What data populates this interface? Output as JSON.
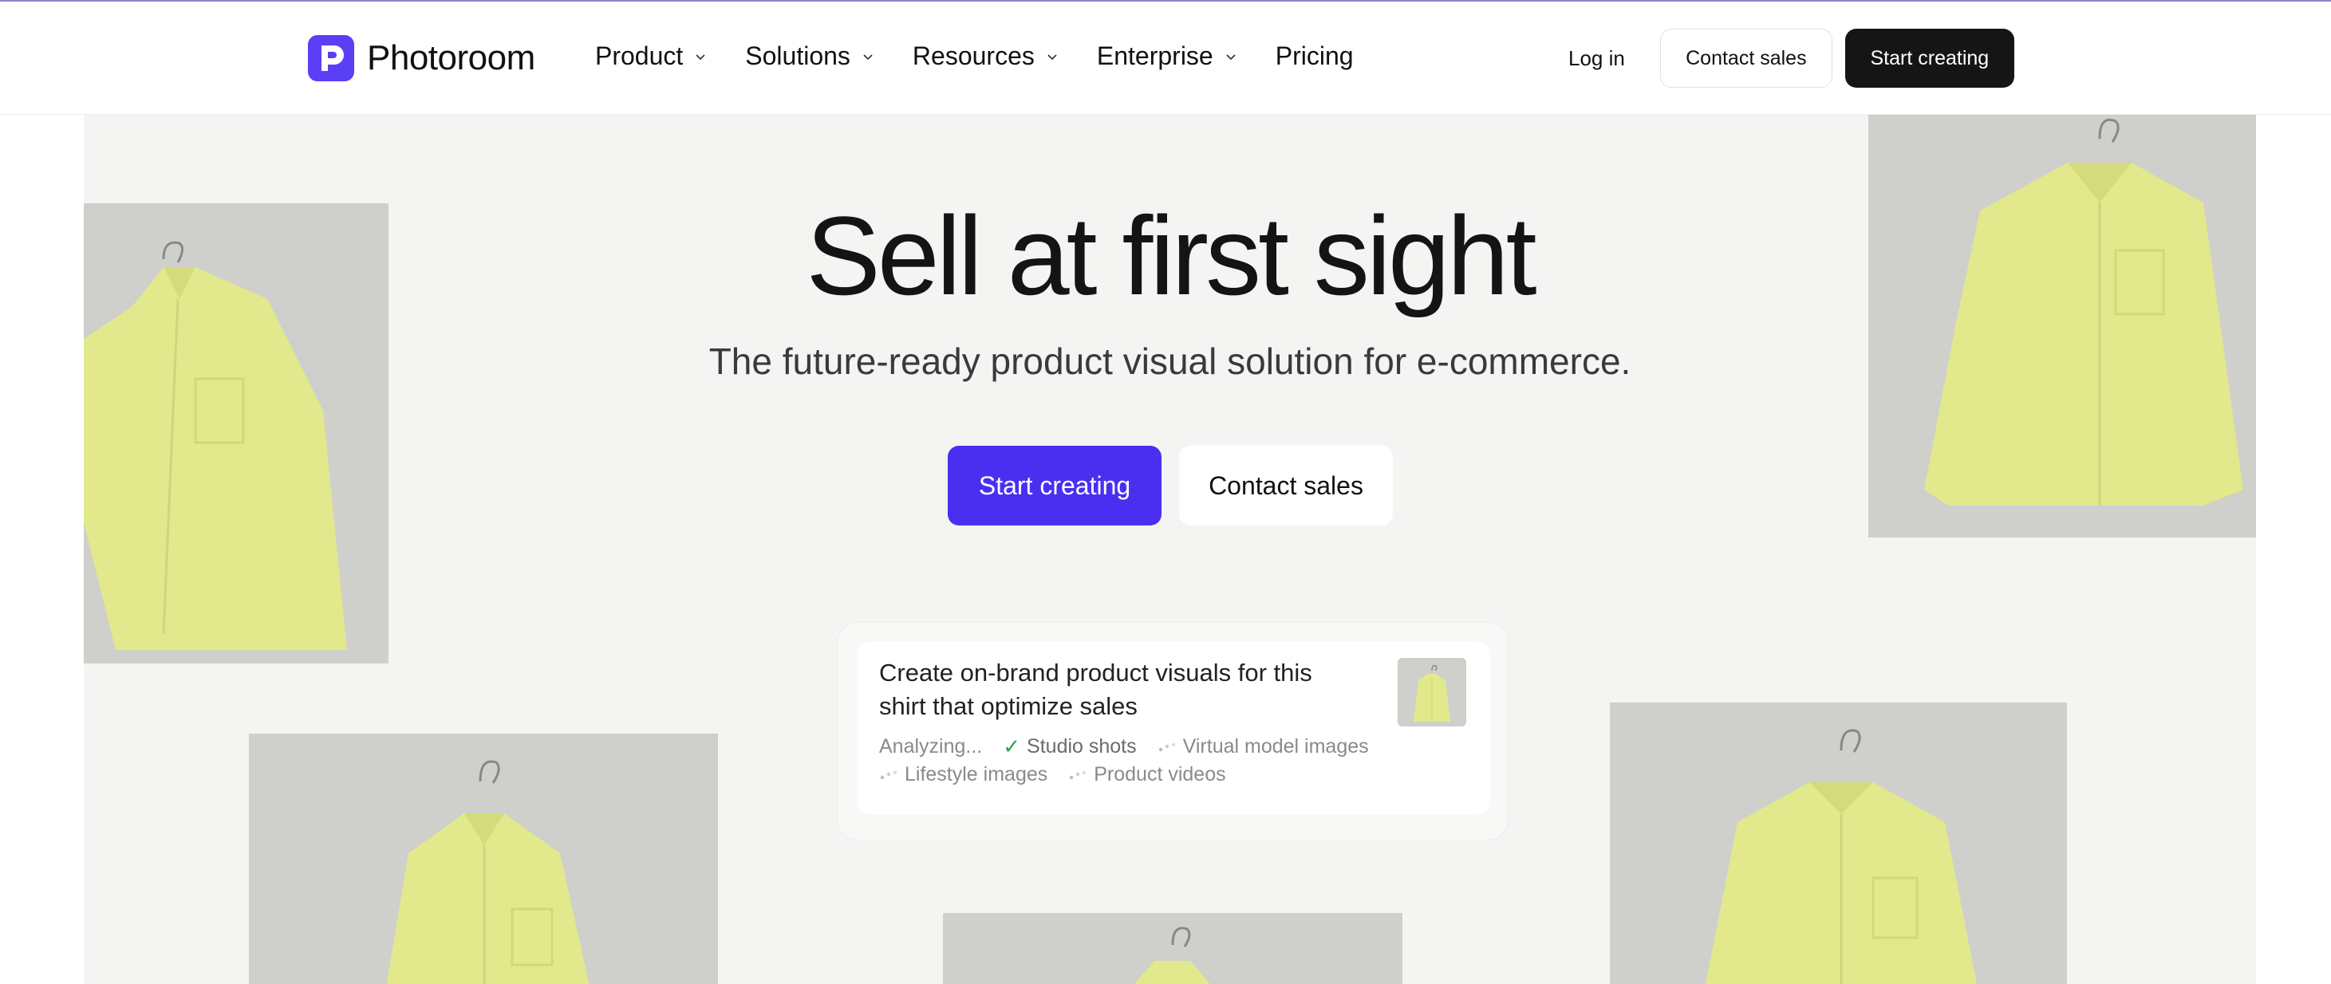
{
  "header": {
    "brand": "Photoroom",
    "nav": [
      {
        "label": "Product",
        "has_dropdown": true
      },
      {
        "label": "Solutions",
        "has_dropdown": true
      },
      {
        "label": "Resources",
        "has_dropdown": true
      },
      {
        "label": "Enterprise",
        "has_dropdown": true
      },
      {
        "label": "Pricing",
        "has_dropdown": false
      }
    ],
    "login": "Log in",
    "contact": "Contact sales",
    "start": "Start creating"
  },
  "hero": {
    "title": "Sell at first sight",
    "subtitle": "The future-ready product visual solution for e-commerce.",
    "cta_primary": "Start creating",
    "cta_secondary": "Contact sales"
  },
  "prompt_card": {
    "text": "Create on-brand product visuals for this shirt that optimize sales",
    "statuses": [
      {
        "label": "Analyzing...",
        "state": "active"
      },
      {
        "label": "Studio shots",
        "state": "done"
      },
      {
        "label": "Virtual model images",
        "state": "pending"
      },
      {
        "label": "Lifestyle images",
        "state": "pending"
      },
      {
        "label": "Product videos",
        "state": "pending"
      }
    ]
  },
  "colors": {
    "brand": "#5b3ff6",
    "primary_button": "#4b2ff0",
    "dark_button": "#151515",
    "hero_background": "#f4f4f3",
    "shirt": "#e3ea8c"
  }
}
